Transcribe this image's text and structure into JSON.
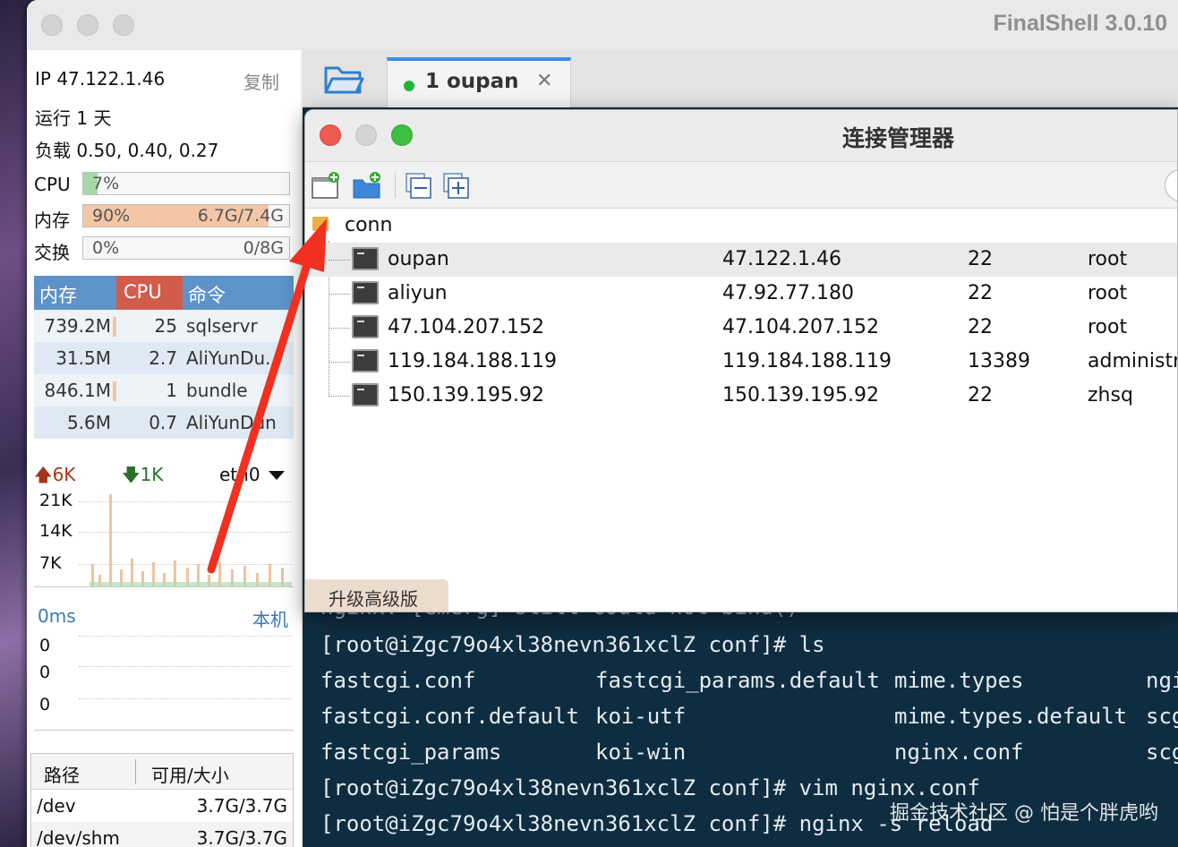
{
  "app": {
    "title": "FinalShell 3.0.10"
  },
  "sidebar": {
    "ip_label": "IP 47.122.1.46",
    "copy_label": "复制",
    "uptime": "运行 1 天",
    "load": "负载 0.50, 0.40, 0.27",
    "cpu": {
      "label": "CPU",
      "text": "7%",
      "percent": 7
    },
    "memory": {
      "label": "内存",
      "text": "90%",
      "detail": "6.7G/7.4G",
      "percent": 90
    },
    "swap": {
      "label": "交换",
      "text": "0%",
      "detail": "0/8G",
      "percent": 0
    },
    "process_table": {
      "headers": [
        "内存",
        "CPU",
        "命令"
      ],
      "rows": [
        {
          "mem": "739.2M",
          "cpu": "25",
          "cmd": "sqlservr"
        },
        {
          "mem": "31.5M",
          "cpu": "2.7",
          "cmd": "AliYunDu..."
        },
        {
          "mem": "846.1M",
          "cpu": "1",
          "cmd": "bundle"
        },
        {
          "mem": "5.6M",
          "cpu": "0.7",
          "cmd": "AliYunDun"
        }
      ]
    },
    "network": {
      "up": "6K",
      "down": "1K",
      "interface": "eth0",
      "y_ticks": [
        "21K",
        "14K",
        "7K"
      ]
    },
    "latency": {
      "left_label": "0ms",
      "right_label": "本机",
      "y_ticks": [
        "0",
        "0",
        "0"
      ]
    },
    "disk_table": {
      "headers": [
        "路径",
        "可用/大小"
      ],
      "rows": [
        {
          "path": "/dev",
          "size": "3.7G/3.7G"
        },
        {
          "path": "/dev/shm",
          "size": "3.7G/3.7G"
        }
      ]
    }
  },
  "tabs": [
    {
      "label": "1 oupan",
      "status_color": "#22b33a"
    }
  ],
  "dialog": {
    "title": "连接管理器",
    "root_folder": "conn",
    "connections": [
      {
        "name": "oupan",
        "host": "47.122.1.46",
        "port": "22",
        "user": "root"
      },
      {
        "name": "aliyun",
        "host": "47.92.77.180",
        "port": "22",
        "user": "root"
      },
      {
        "name": "47.104.207.152",
        "host": "47.104.207.152",
        "port": "22",
        "user": "root"
      },
      {
        "name": "119.184.188.119",
        "host": "119.184.188.119",
        "port": "13389",
        "user": "administr"
      },
      {
        "name": "150.139.195.92",
        "host": "150.139.195.92",
        "port": "22",
        "user": "zhsq"
      }
    ],
    "upgrade_label": "升级高级版"
  },
  "terminal": {
    "partial_line": "nginx: [emerg] still could not bind()",
    "prompt_ls": "[root@iZgc79o4xl38nevn361xclZ conf]# ls",
    "ls_rows": [
      [
        "fastcgi.conf",
        "fastcgi_params.default",
        "mime.types",
        "ngi"
      ],
      [
        "fastcgi.conf.default",
        "koi-utf",
        "mime.types.default",
        "scg"
      ],
      [
        "fastcgi_params",
        "koi-win",
        "nginx.conf",
        "scg"
      ]
    ],
    "prompt_vim": "[root@iZgc79o4xl38nevn361xclZ conf]# vim nginx.conf",
    "prompt_reload": "[root@iZgc79o4xl38nevn361xclZ conf]# nginx -s reload"
  },
  "watermark": "掘金技术社区 @ 怕是个胖虎哟",
  "colors": {
    "accent_blue": "#3a8ee6",
    "cpu_header_red": "#d15c4c",
    "mem_bar": "#f3c6a5",
    "cpu_bar": "#a6d8a6",
    "terminal_bg": "#0f2d40",
    "arrow_red": "#f2301f"
  }
}
